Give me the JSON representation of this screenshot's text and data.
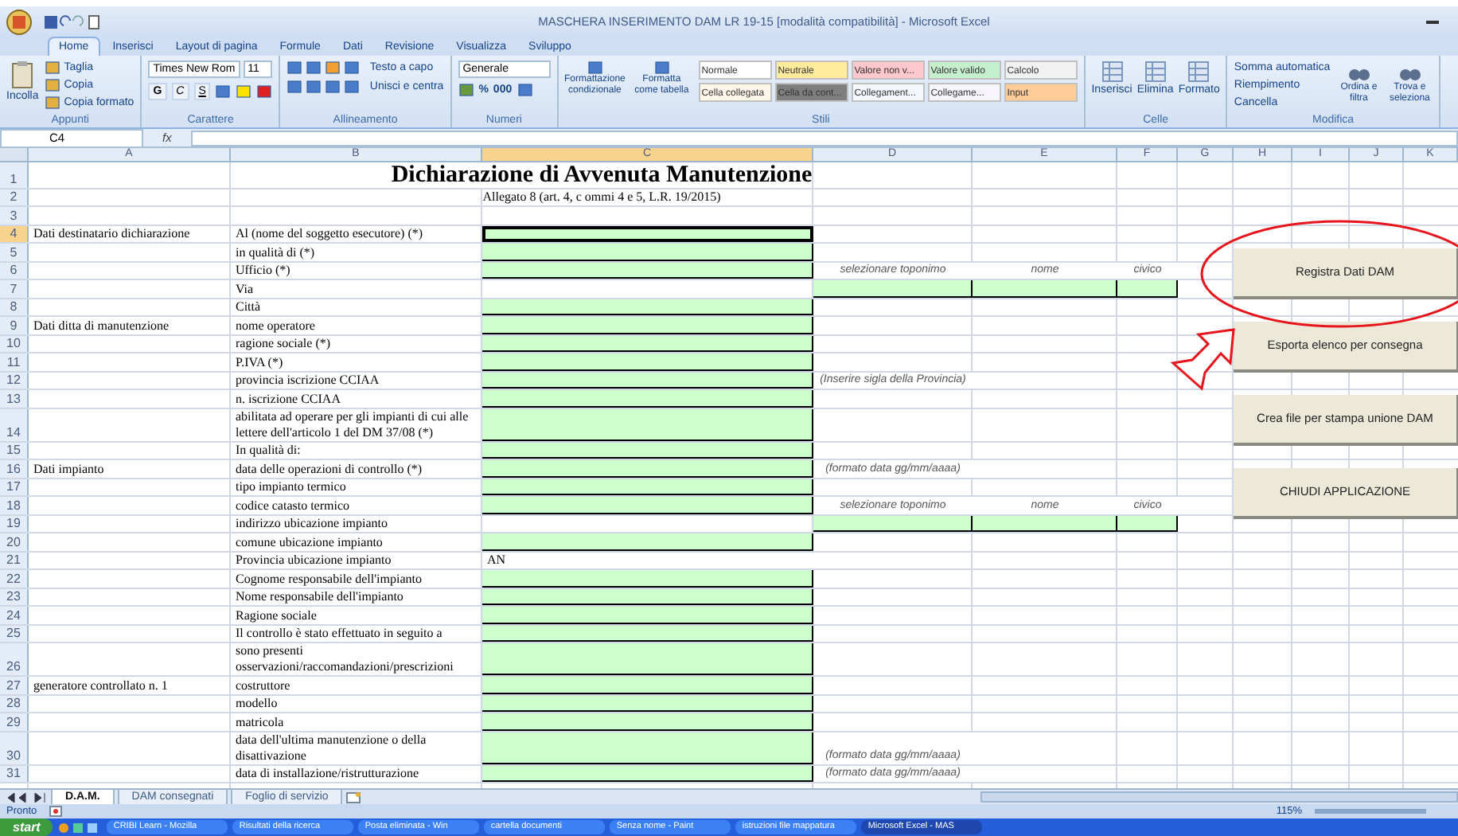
{
  "window": {
    "title": "MASCHERA INSERIMENTO DAM LR 19-15  [modalità compatibilità] - Microsoft Excel"
  },
  "ribbon": {
    "tabs": [
      {
        "label": "Home",
        "selected": true
      },
      {
        "label": "Inserisci",
        "selected": false
      },
      {
        "label": "Layout di pagina",
        "selected": false
      },
      {
        "label": "Formule",
        "selected": false
      },
      {
        "label": "Dati",
        "selected": false
      },
      {
        "label": "Revisione",
        "selected": false
      },
      {
        "label": "Visualizza",
        "selected": false
      },
      {
        "label": "Sviluppo",
        "selected": false
      }
    ],
    "groups": [
      {
        "kind": "clipboard",
        "label": "Appunti",
        "paste": "Incolla",
        "items": [
          "Taglia",
          "Copia",
          "Copia formato"
        ]
      },
      {
        "kind": "font",
        "label": "Carattere",
        "font": "Times New Rom",
        "size": "11",
        "styles": [
          "G",
          "C",
          "S"
        ]
      },
      {
        "kind": "alignment",
        "label": "Allineamento",
        "items": [
          "Testo a capo",
          "Unisci e centra"
        ]
      },
      {
        "kind": "number",
        "label": "Numeri",
        "format": "Generale",
        "items": [
          "%",
          "000"
        ]
      },
      {
        "kind": "styles",
        "label": "Stili",
        "commands": [
          "Formattazione condizionale",
          "Formatta come tabella"
        ],
        "cell_styles": [
          {
            "label": "Normale",
            "color": "#ffffff"
          },
          {
            "label": "Neutrale",
            "color": "#ffeb9c"
          },
          {
            "label": "Valore non v...",
            "color": "#ffc7ce"
          },
          {
            "label": "Valore valido",
            "color": "#c6efce"
          },
          {
            "label": "Calcolo",
            "color": "#f2f2f2"
          },
          {
            "label": "Cella collegata",
            "color": "#fdf6ea"
          },
          {
            "label": "Cella da cont...",
            "color": "#7f7f7f"
          },
          {
            "label": "Collegament...",
            "color": "#f4f7fc"
          },
          {
            "label": "Collegame...",
            "color": "#f8f4fb"
          },
          {
            "label": "Input",
            "color": "#ffcc99"
          }
        ]
      },
      {
        "kind": "cells",
        "label": "Celle",
        "items": [
          "Inserisci",
          "Elimina",
          "Formato"
        ]
      },
      {
        "kind": "editing",
        "label": "Modifica",
        "items": [
          "Somma automatica",
          "Riempimento",
          "Cancella"
        ],
        "large": [
          "Ordina e filtra",
          "Trova e seleziona"
        ]
      }
    ]
  },
  "formula_bar": {
    "name_box": "C4",
    "function_label": "fx"
  },
  "sheet": {
    "columns": [
      {
        "label": "A",
        "selected": false
      },
      {
        "label": "B",
        "selected": false
      },
      {
        "label": "C",
        "selected": true
      },
      {
        "label": "D",
        "selected": false
      },
      {
        "label": "E",
        "selected": false
      },
      {
        "label": "F",
        "selected": false
      },
      {
        "label": "G",
        "selected": false
      },
      {
        "label": "H",
        "selected": false
      },
      {
        "label": "I",
        "selected": false
      },
      {
        "label": "J",
        "selected": false
      },
      {
        "label": "K",
        "selected": false
      }
    ],
    "rows": [
      {
        "number": "1",
        "selected": false,
        "kind": "title",
        "text": "Dichiarazione di Avvenuta Manutenzione"
      },
      {
        "number": "2",
        "selected": false,
        "kind": "subtitle",
        "text": "Allegato 8 (art. 4, c ommi 4 e 5, L.R. 19/2015)"
      },
      {
        "number": "3",
        "selected": false,
        "kind": "field",
        "cells": [
          {
            "input": false
          },
          {
            "input": false
          },
          {
            "input": false
          },
          {
            "input": false
          }
        ]
      },
      {
        "number": "4",
        "selected": true,
        "kind": "field",
        "a": "Dati destinatario dichiarazione",
        "b": "Al (nome del soggetto esecutore) (*)",
        "cells": [
          {
            "input": true
          },
          {
            "input": false
          },
          {
            "input": false
          },
          {
            "input": false
          }
        ]
      },
      {
        "number": "5",
        "selected": false,
        "kind": "field",
        "b": "in qualità di (*)",
        "cells": [
          {
            "input": true
          },
          {
            "input": false
          },
          {
            "input": false
          },
          {
            "input": false
          }
        ]
      },
      {
        "number": "6",
        "selected": false,
        "kind": "field",
        "b": "Ufficio (*)",
        "cells": [
          {
            "input": true
          },
          {
            "input": false,
            "text": "selezionare toponimo",
            "hint": true
          },
          {
            "input": false,
            "text": "nome",
            "hint": true
          },
          {
            "input": false,
            "text": "civico",
            "hint": true
          }
        ]
      },
      {
        "number": "7",
        "selected": false,
        "kind": "field",
        "b": "Via",
        "cells": [
          {
            "input": false
          },
          {
            "input": true
          },
          {
            "input": true
          },
          {
            "input": true
          }
        ]
      },
      {
        "number": "8",
        "selected": false,
        "kind": "field",
        "b": "Città",
        "cells": [
          {
            "input": true
          },
          {
            "input": false
          },
          {
            "input": false
          },
          {
            "input": false
          }
        ]
      },
      {
        "number": "9",
        "selected": false,
        "kind": "field",
        "a": "Dati ditta di manutenzione",
        "b": "nome operatore",
        "cells": [
          {
            "input": true
          },
          {
            "input": false
          },
          {
            "input": false
          },
          {
            "input": false
          }
        ]
      },
      {
        "number": "10",
        "selected": false,
        "kind": "field",
        "b": "ragione sociale (*)",
        "cells": [
          {
            "input": true
          },
          {
            "input": false
          },
          {
            "input": false
          },
          {
            "input": false
          }
        ]
      },
      {
        "number": "11",
        "selected": false,
        "kind": "field",
        "b": "P.IVA (*)",
        "cells": [
          {
            "input": true
          },
          {
            "input": false
          },
          {
            "input": false
          },
          {
            "input": false
          }
        ]
      },
      {
        "number": "12",
        "selected": false,
        "kind": "field",
        "b": "provincia iscrizione CCIAA",
        "cells": [
          {
            "input": true
          },
          {
            "input": false,
            "text": "(Inserire sigla della Provincia)",
            "hint": true
          },
          {
            "input": false
          },
          {
            "input": false
          }
        ]
      },
      {
        "number": "13",
        "selected": false,
        "kind": "field",
        "b": "n. iscrizione CCIAA",
        "cells": [
          {
            "input": true
          },
          {
            "input": false
          },
          {
            "input": false
          },
          {
            "input": false
          }
        ]
      },
      {
        "number": "14",
        "selected": false,
        "kind": "field",
        "b": "abilitata ad operare per gli impianti di cui alle lettere dell'articolo 1 del DM 37/08 (*)",
        "cells": [
          {
            "input": true
          },
          {
            "input": false
          },
          {
            "input": false
          },
          {
            "input": false
          }
        ]
      },
      {
        "number": "15",
        "selected": false,
        "kind": "field",
        "b": "In qualità di:",
        "cells": [
          {
            "input": true
          },
          {
            "input": false
          },
          {
            "input": false
          },
          {
            "input": false
          }
        ]
      },
      {
        "number": "16",
        "selected": false,
        "kind": "field",
        "a": "Dati impianto",
        "b": "data delle operazioni di controllo (*)",
        "cells": [
          {
            "input": true
          },
          {
            "input": false,
            "text": "(formato data gg/mm/aaaa)",
            "hint": true
          },
          {
            "input": false
          },
          {
            "input": false
          }
        ]
      },
      {
        "number": "17",
        "selected": false,
        "kind": "field",
        "b": "tipo impianto termico",
        "cells": [
          {
            "input": true
          },
          {
            "input": false
          },
          {
            "input": false
          },
          {
            "input": false
          }
        ]
      },
      {
        "number": "18",
        "selected": false,
        "kind": "field",
        "b": "codice catasto termico",
        "cells": [
          {
            "input": true
          },
          {
            "input": false,
            "text": "selezionare toponimo",
            "hint": true
          },
          {
            "input": false,
            "text": "nome",
            "hint": true
          },
          {
            "input": false,
            "text": "civico",
            "hint": true
          }
        ]
      },
      {
        "number": "19",
        "selected": false,
        "kind": "field",
        "b": "indirizzo ubicazione impianto",
        "cells": [
          {
            "input": false
          },
          {
            "input": true
          },
          {
            "input": true
          },
          {
            "input": true
          }
        ]
      },
      {
        "number": "20",
        "selected": false,
        "kind": "field",
        "b": "comune ubicazione impianto",
        "cells": [
          {
            "input": true
          },
          {
            "input": false
          },
          {
            "input": false
          },
          {
            "input": false
          }
        ]
      },
      {
        "number": "21",
        "selected": false,
        "kind": "field",
        "b": "Provincia ubicazione impianto",
        "value": "AN",
        "cells": [
          {
            "input": false
          },
          {
            "input": false
          },
          {
            "input": false
          },
          {
            "input": false
          }
        ]
      },
      {
        "number": "22",
        "selected": false,
        "kind": "field",
        "b": "Cognome responsabile dell'impianto",
        "cells": [
          {
            "input": true
          },
          {
            "input": false
          },
          {
            "input": false
          },
          {
            "input": false
          }
        ]
      },
      {
        "number": "23",
        "selected": false,
        "kind": "field",
        "b": "Nome responsabile dell'impianto",
        "cells": [
          {
            "input": true
          },
          {
            "input": false
          },
          {
            "input": false
          },
          {
            "input": false
          }
        ]
      },
      {
        "number": "24",
        "selected": false,
        "kind": "field",
        "b": "Ragione sociale",
        "cells": [
          {
            "input": true
          },
          {
            "input": false
          },
          {
            "input": false
          },
          {
            "input": false
          }
        ]
      },
      {
        "number": "25",
        "selected": false,
        "kind": "field",
        "b": "Il controllo è stato effettuato in seguito a",
        "cells": [
          {
            "input": true
          },
          {
            "input": false
          },
          {
            "input": false
          },
          {
            "input": false
          }
        ]
      },
      {
        "number": "26",
        "selected": false,
        "kind": "field",
        "b": "sono presenti osservazioni/raccomandazioni/prescrizioni",
        "cells": [
          {
            "input": true
          },
          {
            "input": false
          },
          {
            "input": false
          },
          {
            "input": false
          }
        ]
      },
      {
        "number": "27",
        "selected": false,
        "kind": "field",
        "a": "generatore controllato n. 1",
        "b": "costruttore",
        "cells": [
          {
            "input": true
          },
          {
            "input": false
          },
          {
            "input": false
          },
          {
            "input": false
          }
        ]
      },
      {
        "number": "28",
        "selected": false,
        "kind": "field",
        "b": "modello",
        "cells": [
          {
            "input": true
          },
          {
            "input": false
          },
          {
            "input": false
          },
          {
            "input": false
          }
        ]
      },
      {
        "number": "29",
        "selected": false,
        "kind": "field",
        "b": "matricola",
        "cells": [
          {
            "input": true
          },
          {
            "input": false
          },
          {
            "input": false
          },
          {
            "input": false
          }
        ]
      },
      {
        "number": "30",
        "selected": false,
        "kind": "field",
        "b": "data dell'ultima manutenzione o della disattivazione",
        "cells": [
          {
            "input": true
          },
          {
            "input": false,
            "text": "(formato data gg/mm/aaaa)",
            "hint": true
          },
          {
            "input": false
          },
          {
            "input": false
          }
        ]
      },
      {
        "number": "31",
        "selected": false,
        "kind": "field",
        "b": "data di installazione/ristrutturazione",
        "cells": [
          {
            "input": true
          },
          {
            "input": false,
            "text": "(formato data gg/mm/aaaa)",
            "hint": true
          },
          {
            "input": false
          },
          {
            "input": false
          }
        ]
      }
    ],
    "buttons": [
      {
        "label": "Registra Dati DAM",
        "circled": true
      },
      {
        "label": "Esporta elenco per consegna",
        "circled": false
      },
      {
        "label": "Crea file per stampa unione DAM",
        "circled": false
      },
      {
        "label": "CHIUDI APPLICAZIONE",
        "circled": false
      }
    ]
  },
  "sheet_tabs": [
    {
      "label": "D.A.M.",
      "selected": true
    },
    {
      "label": "DAM consegnati",
      "selected": false
    },
    {
      "label": "Foglio di servizio",
      "selected": false
    }
  ],
  "status_bar": {
    "status": "Pronto",
    "zoom": "115%"
  },
  "taskbar": {
    "start": "start",
    "windows": [
      {
        "label": "CRIBI Learn - Mozilla",
        "selected": false
      },
      {
        "label": "Risultati della ricerca",
        "selected": false
      },
      {
        "label": "Posta eliminata - Win",
        "selected": false
      },
      {
        "label": "cartella documenti",
        "selected": false
      },
      {
        "label": "Senza nome - Paint",
        "selected": false
      },
      {
        "label": "istruzioni file mappatura",
        "selected": false
      },
      {
        "label": "Microsoft Excel - MAS",
        "selected": true
      }
    ]
  }
}
